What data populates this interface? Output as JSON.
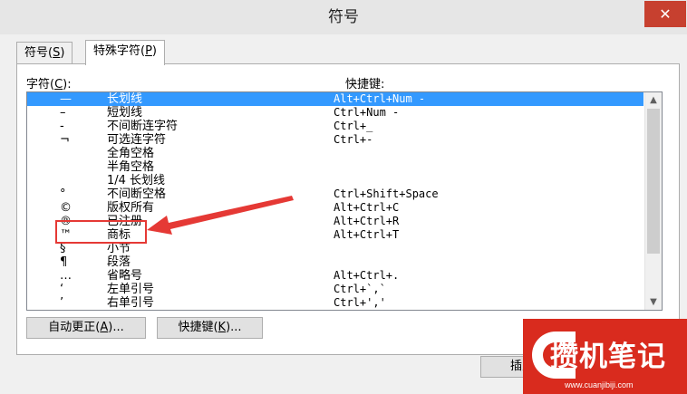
{
  "window": {
    "title": "符号",
    "close_glyph": "✕"
  },
  "tabs": [
    {
      "label": "符号(S)",
      "prefix": "符号(",
      "key": "S",
      "suffix": ")",
      "active": false
    },
    {
      "label": "特殊字符(P)",
      "prefix": "特殊字符(",
      "key": "P",
      "suffix": ")",
      "active": true
    }
  ],
  "list": {
    "col_char_label": "字符(C):",
    "col_char_prefix": "字符(",
    "col_char_key": "C",
    "col_char_suffix": "):",
    "col_shortcut_label": "快捷键:",
    "selected_index": 0,
    "rows": [
      {
        "char": "—",
        "name": "长划线",
        "shortcut": "Alt+Ctrl+Num -"
      },
      {
        "char": "–",
        "name": "短划线",
        "shortcut": "Ctrl+Num -"
      },
      {
        "char": "‑",
        "name": "不间断连字符",
        "shortcut": "Ctrl+_"
      },
      {
        "char": "¬",
        "name": "可选连字符",
        "shortcut": "Ctrl+-"
      },
      {
        "char": "",
        "name": "全角空格",
        "shortcut": ""
      },
      {
        "char": "",
        "name": "半角空格",
        "shortcut": ""
      },
      {
        "char": "",
        "name": "1/4 长划线",
        "shortcut": ""
      },
      {
        "char": "°",
        "name": "不间断空格",
        "shortcut": "Ctrl+Shift+Space"
      },
      {
        "char": "©",
        "name": "版权所有",
        "shortcut": "Alt+Ctrl+C"
      },
      {
        "char": "®",
        "name": "已注册",
        "shortcut": "Alt+Ctrl+R"
      },
      {
        "char": "™",
        "name": "商标",
        "shortcut": "Alt+Ctrl+T"
      },
      {
        "char": "§",
        "name": "小节",
        "shortcut": ""
      },
      {
        "char": "¶",
        "name": "段落",
        "shortcut": ""
      },
      {
        "char": "…",
        "name": "省略号",
        "shortcut": "Alt+Ctrl+."
      },
      {
        "char": "‘",
        "name": "左单引号",
        "shortcut": "Ctrl+`,`"
      },
      {
        "char": "’",
        "name": "右单引号",
        "shortcut": "Ctrl+','"
      }
    ]
  },
  "buttons": {
    "autocorrect": {
      "prefix": "自动更正(",
      "key": "A",
      "suffix": ")..."
    },
    "shortcut": {
      "prefix": "快捷键(",
      "key": "K",
      "suffix": ")..."
    },
    "insert": {
      "label": "插入"
    }
  },
  "watermark": {
    "text": "攒机笔记",
    "url": "www.cuanjibiji.com"
  },
  "colors": {
    "selection": "#3399ff",
    "close": "#c7402f",
    "annotation": "#e53935",
    "watermark_bg": "#d92b1e"
  }
}
